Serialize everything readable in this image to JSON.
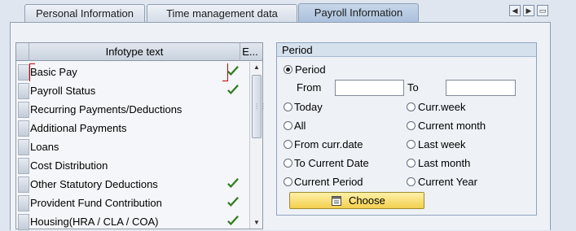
{
  "tabs": [
    {
      "label": "Personal Information",
      "active": false
    },
    {
      "label": "Time management data",
      "active": false
    },
    {
      "label": "Payroll Information",
      "active": true
    }
  ],
  "tab_nav": {
    "prev_icon": "triangle-left",
    "next_icon": "triangle-right",
    "list_icon": "tab-list"
  },
  "table": {
    "columns": [
      "Infotype text",
      "E..."
    ],
    "rows": [
      {
        "text": "Basic Pay",
        "checked": true
      },
      {
        "text": "Payroll Status",
        "checked": true
      },
      {
        "text": "Recurring Payments/Deductions",
        "checked": false
      },
      {
        "text": "Additional Payments",
        "checked": false
      },
      {
        "text": "Loans",
        "checked": false
      },
      {
        "text": "Cost Distribution",
        "checked": false
      },
      {
        "text": "Other Statutory Deductions",
        "checked": true
      },
      {
        "text": "Provident Fund Contribution",
        "checked": true
      },
      {
        "text": "Housing(HRA / CLA / COA)",
        "checked": true
      }
    ]
  },
  "period": {
    "title": "Period",
    "selected": "Period",
    "period_label": "Period",
    "from_label": "From",
    "to_label": "To",
    "from_value": "",
    "to_value": "",
    "options_left": [
      "Today",
      "All",
      "From curr.date",
      "To Current Date",
      "Current Period"
    ],
    "options_right": [
      "Curr.week",
      "Current month",
      "Last week",
      "Last month",
      "Current Year"
    ],
    "choose_label": "Choose"
  },
  "colors": {
    "accent_tab": "#aac0dc",
    "choose_button": "#f2cf4e",
    "check": "#2f7d1f"
  }
}
